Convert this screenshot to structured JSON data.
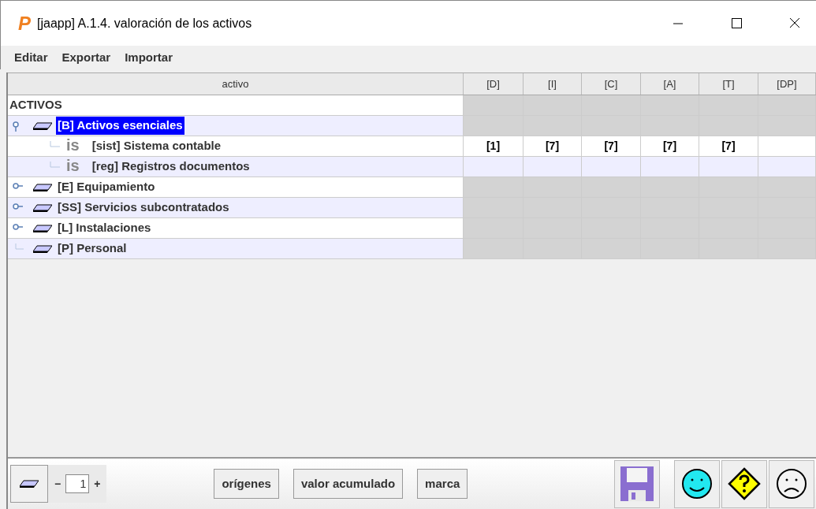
{
  "window": {
    "title": "[jaapp] A.1.4. valoración de los activos",
    "logo": "P"
  },
  "menu": [
    "Editar",
    "Exportar",
    "Importar"
  ],
  "table": {
    "columns": [
      "activo",
      "[D]",
      "[I]",
      "[C]",
      "[A]",
      "[T]",
      "[DP]"
    ],
    "tree": {
      "label": "ACTIVOS",
      "selected": false,
      "children": [
        {
          "label": "[B] Activos esenciales",
          "selected": true,
          "expanded": true,
          "children": [
            {
              "kind": "asset",
              "label": "[sist] Sistema contable",
              "badge": "is",
              "selected": false,
              "values": [
                "[1]",
                "[7]",
                "[7]",
                "[7]",
                "[7]"
              ]
            },
            {
              "kind": "asset",
              "label": "[reg] Registros documentos",
              "badge": "is",
              "selected": false
            }
          ]
        },
        {
          "label": "[E] Equipamiento",
          "selected": false,
          "expanded": false
        },
        {
          "label": "[SS] Servicios subcontratados",
          "selected": false,
          "expanded": false
        },
        {
          "label": "[L] Instalaciones",
          "selected": false,
          "expanded": false
        },
        {
          "label": "[P] Personal",
          "selected": false
        }
      ]
    }
  },
  "toolbar": {
    "minus": "−",
    "level": "1",
    "plus": "+",
    "buttons": [
      "orígenes",
      "valor acumulado",
      "marca"
    ]
  }
}
